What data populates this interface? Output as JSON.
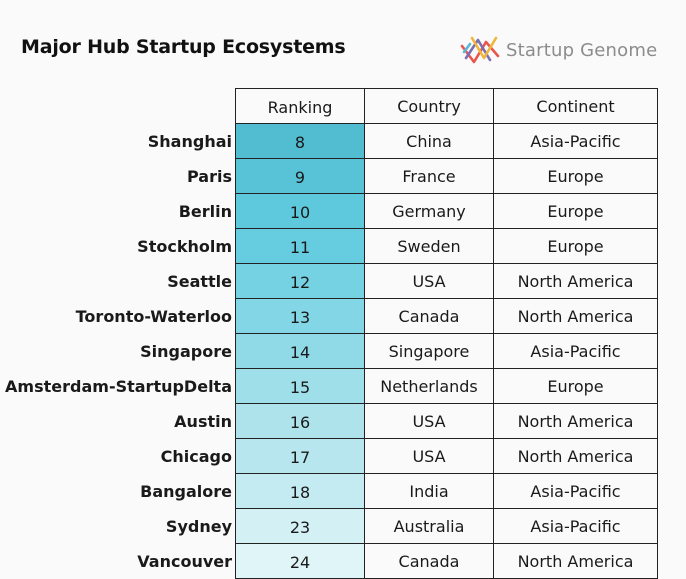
{
  "chart_data": {
    "type": "table",
    "title": "Major Hub Startup Ecosystems",
    "columns": [
      "Ranking",
      "Country",
      "Continent"
    ],
    "rows": [
      {
        "city": "Shanghai",
        "ranking": 8,
        "country": "China",
        "continent": "Asia-Pacific"
      },
      {
        "city": "Paris",
        "ranking": 9,
        "country": "France",
        "continent": "Europe"
      },
      {
        "city": "Berlin",
        "ranking": 10,
        "country": "Germany",
        "continent": "Europe"
      },
      {
        "city": "Stockholm",
        "ranking": 11,
        "country": "Sweden",
        "continent": "Europe"
      },
      {
        "city": "Seattle",
        "ranking": 12,
        "country": "USA",
        "continent": "North America"
      },
      {
        "city": "Toronto-Waterloo",
        "ranking": 13,
        "country": "Canada",
        "continent": "North America"
      },
      {
        "city": "Singapore",
        "ranking": 14,
        "country": "Singapore",
        "continent": "Asia-Pacific"
      },
      {
        "city": "Amsterdam-StartupDelta",
        "ranking": 15,
        "country": "Netherlands",
        "continent": "Europe"
      },
      {
        "city": "Austin",
        "ranking": 16,
        "country": "USA",
        "continent": "North America"
      },
      {
        "city": "Chicago",
        "ranking": 17,
        "country": "USA",
        "continent": "North America"
      },
      {
        "city": "Bangalore",
        "ranking": 18,
        "country": "India",
        "continent": "Asia-Pacific"
      },
      {
        "city": "Sydney",
        "ranking": 23,
        "country": "Australia",
        "continent": "Asia-Pacific"
      },
      {
        "city": "Vancouver",
        "ranking": 24,
        "country": "Canada",
        "continent": "North America"
      }
    ],
    "ranking_colors": [
      "#52bcd1",
      "#58c3d6",
      "#5ec8dc",
      "#66cde0",
      "#74d2e3",
      "#82d6e5",
      "#90dae7",
      "#9fdfea",
      "#aee3ec",
      "#b8e6ee",
      "#c4ebf1",
      "#d3f1f5",
      "#e0f5f8"
    ]
  },
  "logo": {
    "text": "Startup Genome",
    "icon": "startup-genome-helix-icon",
    "colors": [
      "#e8564f",
      "#7b6fb3",
      "#f0b63c",
      "#5bb7d6"
    ]
  }
}
